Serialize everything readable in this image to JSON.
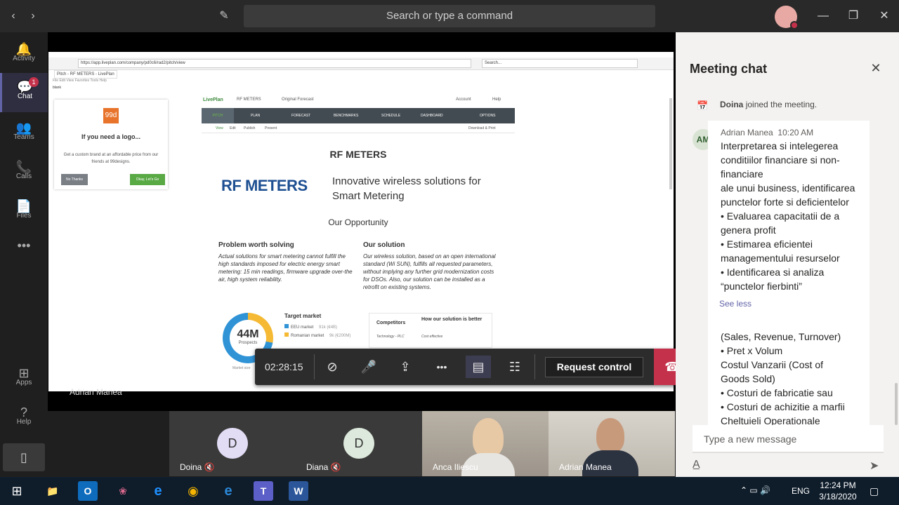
{
  "topbar": {
    "search_placeholder": "Search or type a command",
    "back_glyph": "‹",
    "forward_glyph": "›",
    "compose_glyph": "✎",
    "min_glyph": "—",
    "max_glyph": "❐",
    "close_glyph": "✕"
  },
  "rail": {
    "items": [
      {
        "label": "Activity",
        "icon": "🔔"
      },
      {
        "label": "Chat",
        "icon": "💬",
        "badge": "1"
      },
      {
        "label": "Teams",
        "icon": "👥"
      },
      {
        "label": "Calls",
        "icon": "📞"
      },
      {
        "label": "Files",
        "icon": "📄"
      },
      {
        "label": "",
        "icon": "•••"
      },
      {
        "label": "Apps",
        "icon": "⊞"
      },
      {
        "label": "Help",
        "icon": "?"
      }
    ],
    "device_icon": "▯"
  },
  "share": {
    "presenter_name": "Adrian Manea",
    "browser": {
      "url": "https://app.liveplan.com/company/pd0c6/rad2/pitch/view",
      "search": "Search...",
      "tab": "Pitch - RF METERS - LivePlan",
      "menu": "File   Edit   View   Favorites   Tools   Help",
      "fav": "blank"
    },
    "ad": {
      "logo": "99d",
      "title": "If you need a logo...",
      "text": "Get a custom brand at an affordable price from our friends at 99designs.",
      "no": "No Thanks",
      "ok": "Okay, Let's Go"
    },
    "liveplan": {
      "brand": "LivePlan",
      "company": "RF METERS",
      "forecast": "Original Forecast",
      "account": "Account",
      "help": "Help",
      "nav": [
        "PITCH",
        "PLAN",
        "FORECAST",
        "BENCHMARKS",
        "SCHEDULE",
        "DASHBOARD",
        "OPTIONS"
      ],
      "sub": [
        "View",
        "Edit",
        "Publish",
        "Present"
      ],
      "download": "Download & Print",
      "title": "RF METERS",
      "logo": "RF METERS",
      "tagline": "Innovative wireless solutions for Smart Metering",
      "opportunity": "Our Opportunity",
      "problem_h": "Problem worth solving",
      "problem_p": "Actual solutions for smart metering cannot fulfill the high standards imposed for electric energy smart metering: 15 min readings, firmware upgrade over-the air, high system reliability.",
      "solution_h": "Our solution",
      "solution_p": "Our wireless solution, based on an open international standard (Wi SUN), fulfills all requested parameters, without implying any further grid modernization costs for DSOs. Also, our solution can be installed as a retrofit on existing systems.",
      "donut_value": "44M",
      "donut_label": "Prospects",
      "donut_share": 0.28,
      "market_caption": "Market size",
      "target_title": "Target market",
      "target_items": [
        {
          "label": "EEU market",
          "value": "91k (€4B)",
          "color": "#2f93d6"
        },
        {
          "label": "Romanian market",
          "value": "9k (€200M)",
          "color": "#f5b933"
        }
      ],
      "comp_h1": "Competitors",
      "comp_h2": "How our solution is better",
      "comp_r1": "Technology - PLC",
      "comp_r2": "Cost effective"
    }
  },
  "controls": {
    "timer": "02:28:15",
    "request_control": "Request control",
    "video_glyph": "⊘",
    "mic_glyph": "🎤",
    "share_glyph": "⇪",
    "more_glyph": "•••",
    "chat_glyph": "▤",
    "people_glyph": "☷",
    "hangup_glyph": "☎"
  },
  "participants": [
    {
      "name": "Doina",
      "initial": "D",
      "muted": "🔇",
      "color": "#e2dcf5"
    },
    {
      "name": "Diana",
      "initial": "D",
      "muted": "🔇",
      "color": "#dce9dc"
    },
    {
      "name": "Anca Iliescu",
      "initial": "",
      "muted": "",
      "color": ""
    },
    {
      "name": "Adrian Manea",
      "initial": "",
      "muted": "",
      "color": ""
    }
  ],
  "chat": {
    "title": "Meeting chat",
    "close_glyph": "✕",
    "join_icon": "📅",
    "join_name": "Doina",
    "join_text": "joined the meeting.",
    "msg1": {
      "avatar": "AM",
      "author": "Adrian Manea",
      "time": "10:20 AM",
      "lines": [
        "Interpretarea si intelegerea",
        "conditiilor financiare si non-",
        "financiare",
        "ale unui business, identificarea",
        "punctelor forte si deficientelor",
        "• Evaluarea capacitatii de a",
        "genera profit",
        "• Estimarea eficientei",
        "managementului resurselor",
        "• Identificarea si analiza",
        "“punctelor fierbinti”"
      ],
      "see_less": "See less"
    },
    "msg2": {
      "lines": [
        "(Sales, Revenue, Turnover)",
        "• Pret x Volum",
        " Costul Vanzarii (Cost of",
        "Goods Sold)",
        "• Costuri de fabricatie sau",
        "• Costuri de achizitie a marfii",
        " Cheltuieli Operationale"
      ]
    },
    "compose_placeholder": "Type a new message",
    "format_glyph": "A̲",
    "send_glyph": "➤"
  },
  "taskbar": {
    "apps": [
      {
        "name": "windows",
        "glyph": "⊞"
      },
      {
        "name": "file-explorer",
        "glyph": "📁"
      },
      {
        "name": "outlook",
        "glyph": "O"
      },
      {
        "name": "app",
        "glyph": "❀"
      },
      {
        "name": "internet-explorer",
        "glyph": "e"
      },
      {
        "name": "chrome",
        "glyph": "◉"
      },
      {
        "name": "edge",
        "glyph": "e"
      },
      {
        "name": "teams",
        "glyph": "T"
      },
      {
        "name": "word",
        "glyph": "W"
      }
    ],
    "tray": "⌃  ▭  🔊",
    "lang": "ENG",
    "time": "12:24 PM",
    "date": "3/18/2020",
    "notif_glyph": "▢"
  }
}
